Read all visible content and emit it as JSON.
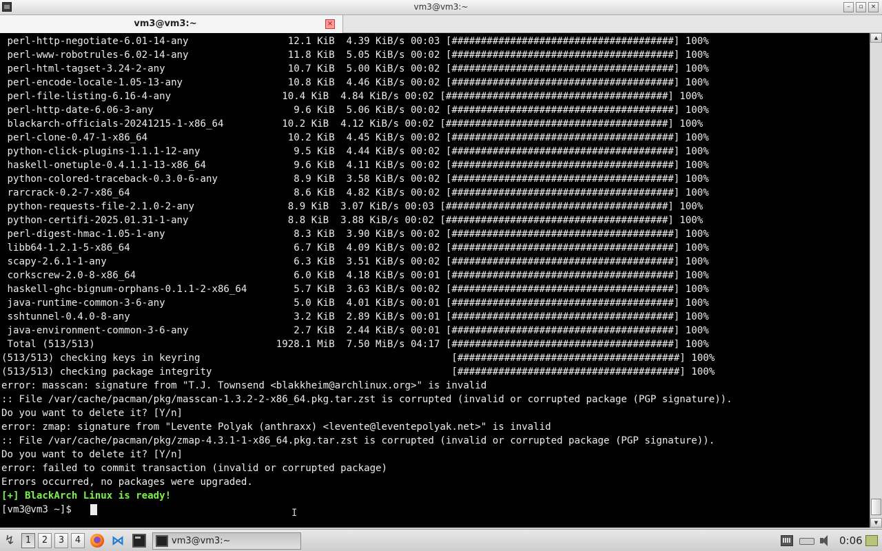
{
  "window": {
    "title": "vm3@vm3:~",
    "buttons": {
      "minimize": "–",
      "maximize": "▫",
      "close": "×"
    }
  },
  "tab": {
    "label": "vm3@vm3:~",
    "close": "×"
  },
  "terminal": {
    "lines": [
      " perl-http-negotiate-6.01-14-any                 12.1 KiB  4.39 KiB/s 00:03 [######################################] 100%",
      " perl-www-robotrules-6.02-14-any                 11.8 KiB  5.05 KiB/s 00:02 [######################################] 100%",
      " perl-html-tagset-3.24-2-any                     10.7 KiB  5.00 KiB/s 00:02 [######################################] 100%",
      " perl-encode-locale-1.05-13-any                  10.8 KiB  4.46 KiB/s 00:02 [######################################] 100%",
      " perl-file-listing-6.16-4-any                   10.4 KiB  4.84 KiB/s 00:02 [######################################] 100%",
      " perl-http-date-6.06-3-any                        9.6 KiB  5.06 KiB/s 00:02 [######################################] 100%",
      " blackarch-officials-20241215-1-x86_64          10.2 KiB  4.12 KiB/s 00:02 [######################################] 100%",
      " perl-clone-0.47-1-x86_64                        10.2 KiB  4.45 KiB/s 00:02 [######################################] 100%",
      " python-click-plugins-1.1.1-12-any                9.5 KiB  4.44 KiB/s 00:02 [######################################] 100%",
      " haskell-onetuple-0.4.1.1-13-x86_64               9.6 KiB  4.11 KiB/s 00:02 [######################################] 100%",
      " python-colored-traceback-0.3.0-6-any             8.9 KiB  3.58 KiB/s 00:02 [######################################] 100%",
      " rarcrack-0.2-7-x86_64                            8.6 KiB  4.82 KiB/s 00:02 [######################################] 100%",
      " python-requests-file-2.1.0-2-any                8.9 KiB  3.07 KiB/s 00:03 [######################################] 100%",
      " python-certifi-2025.01.31-1-any                 8.8 KiB  3.88 KiB/s 00:02 [######################################] 100%",
      " perl-digest-hmac-1.05-1-any                      8.3 KiB  3.90 KiB/s 00:02 [######################################] 100%",
      " libb64-1.2.1-5-x86_64                            6.7 KiB  4.09 KiB/s 00:02 [######################################] 100%",
      " scapy-2.6.1-1-any                                6.3 KiB  3.51 KiB/s 00:02 [######################################] 100%",
      " corkscrew-2.0-8-x86_64                           6.0 KiB  4.18 KiB/s 00:01 [######################################] 100%",
      " haskell-ghc-bignum-orphans-0.1.1-2-x86_64        5.7 KiB  3.63 KiB/s 00:02 [######################################] 100%",
      " java-runtime-common-3-6-any                      5.0 KiB  4.01 KiB/s 00:01 [######################################] 100%",
      " sshtunnel-0.4.0-8-any                            3.2 KiB  2.89 KiB/s 00:01 [######################################] 100%",
      " java-environment-common-3-6-any                  2.7 KiB  2.44 KiB/s 00:01 [######################################] 100%",
      " Total (513/513)                               1928.1 MiB  7.50 MiB/s 04:17 [######################################] 100%",
      "(513/513) checking keys in keyring                                           [######################################] 100%",
      "(513/513) checking package integrity                                         [######################################] 100%",
      "error: masscan: signature from \"T.J. Townsend <blakkheim@archlinux.org>\" is invalid",
      ":: File /var/cache/pacman/pkg/masscan-1.3.2-2-x86_64.pkg.tar.zst is corrupted (invalid or corrupted package (PGP signature)).",
      "Do you want to delete it? [Y/n]",
      "error: zmap: signature from \"Levente Polyak (anthraxx) <levente@leventepolyak.net>\" is invalid",
      ":: File /var/cache/pacman/pkg/zmap-4.3.1-1-x86_64.pkg.tar.zst is corrupted (invalid or corrupted package (PGP signature)).",
      "Do you want to delete it? [Y/n]",
      "error: failed to commit transaction (invalid or corrupted package)",
      "Errors occurred, no packages were upgraded."
    ],
    "ready_line": "[+] BlackArch Linux is ready!",
    "prompt": "[vm3@vm3 ~]$ "
  },
  "taskbar": {
    "workspaces": [
      "1",
      "2",
      "3",
      "4"
    ],
    "active_workspace": "1",
    "launchers": [
      "start-menu-icon",
      "firefox-icon",
      "vscode-icon",
      "terminal-icon"
    ],
    "task_label": "vm3@vm3:~",
    "clock": "0:06"
  }
}
